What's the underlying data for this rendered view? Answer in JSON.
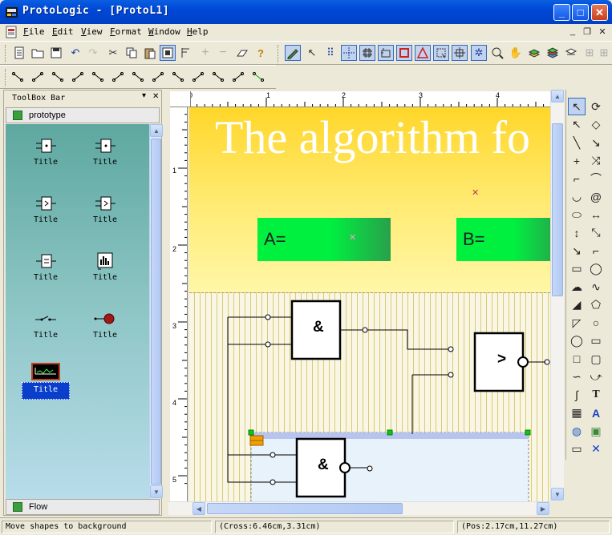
{
  "window": {
    "title": "ProtoLogic - [ProtoL1]",
    "controls": {
      "minimize": "_",
      "maximize": "□",
      "close": "✕"
    }
  },
  "menubar": {
    "items": [
      "File",
      "Edit",
      "View",
      "Format",
      "Window",
      "Help"
    ],
    "mdi_controls": {
      "minimize": "_",
      "restore": "❐",
      "close": "✕"
    }
  },
  "toolbar_main": {
    "icons": [
      "new-document-icon",
      "open-folder-icon",
      "save-icon",
      "undo-icon",
      "redo-icon",
      "cut-icon",
      "copy-icon",
      "paste-icon",
      "print-preview-icon",
      "align-icon",
      "add-icon",
      "remove-icon",
      "eraser-icon",
      "help-icon",
      "edit-mode-icon",
      "select-mode-icon",
      "grid-dots-icon",
      "snap-grid-icon",
      "grid-icon",
      "frame-icon",
      "red-square-icon",
      "triangle-icon",
      "select-icon",
      "crosshair-icon",
      "gear-icon",
      "zoom-icon",
      "hand-icon",
      "layer-icon",
      "layers-icon",
      "run-icon",
      "grid-extra-icon"
    ]
  },
  "toolbar_connect": {
    "icons": [
      "connector-1-icon",
      "connector-2-icon",
      "connector-3-icon",
      "connector-4-icon",
      "connector-5-icon",
      "connector-6-icon",
      "connector-7-icon",
      "connector-8-icon",
      "connector-9-icon",
      "connector-10-icon",
      "connector-11-icon",
      "connector-12-icon",
      "connector-13-icon"
    ]
  },
  "toolbox": {
    "title": "ToolBox Bar",
    "pin": "▾",
    "close": "✕",
    "section": "prototype",
    "footer_section": "Flow",
    "items": [
      {
        "label": "Title",
        "icon": "gate-and-icon"
      },
      {
        "label": "Title",
        "icon": "gate-and2-icon"
      },
      {
        "label": "Title",
        "icon": "gate-greater-icon"
      },
      {
        "label": "Title",
        "icon": "gate-greater2-icon"
      },
      {
        "label": "Title",
        "icon": "gate-equal-icon"
      },
      {
        "label": "Title",
        "icon": "bar-chart-icon"
      },
      {
        "label": "Title",
        "icon": "switch-icon"
      },
      {
        "label": "Title",
        "icon": "lamp-icon"
      },
      {
        "label": "Title",
        "icon": "display-icon"
      }
    ]
  },
  "rulers": {
    "horizontal": [
      "0",
      "1",
      "2",
      "3",
      "4"
    ],
    "vertical": [
      "1",
      "2",
      "3",
      "4",
      "5"
    ]
  },
  "canvas": {
    "heading": "The algorithm fo",
    "var_a": "A=",
    "var_b": "B=",
    "gate_and_1": "&",
    "gate_greater": ">",
    "gate_and_2": "&",
    "colors": {
      "panel_top": "#ffd629",
      "panel_bottom": "#fff7a8",
      "var_box": "#00f040",
      "selection_handle": "#00c000"
    }
  },
  "drawtools": {
    "icons": [
      "pointer-icon",
      "rotate-icon",
      "node-edit-icon",
      "shape-edit-icon",
      "line-icon",
      "arrow-line-icon",
      "cross-icon",
      "bezier-icon",
      "polyline-icon",
      "arc-icon",
      "curve-icon",
      "spiral-icon",
      "ellipse-icon",
      "dimension-h-icon",
      "dimension-v-icon",
      "dimension-d-icon",
      "measure-icon",
      "measure2-icon",
      "callout-icon",
      "callout2-icon",
      "cloud-icon",
      "freehand-icon",
      "fill-icon",
      "polygon-icon",
      "shape-icon",
      "circle-outline-icon",
      "circle-icon",
      "rectangle-icon",
      "square-icon",
      "rounded-square-icon",
      "wave-icon",
      "spline-icon",
      "s-curve-icon",
      "text-icon",
      "table-icon",
      "text-art-icon",
      "globe-icon",
      "image-icon",
      "window-icon",
      "delete-icon"
    ],
    "text_tool": "T",
    "delete_tool": "✕"
  },
  "statusbar": {
    "hint": "Move shapes to background",
    "cross": "(Cross:6.46cm,3.31cm)",
    "pos": "(Pos:2.17cm,11.27cm)"
  }
}
